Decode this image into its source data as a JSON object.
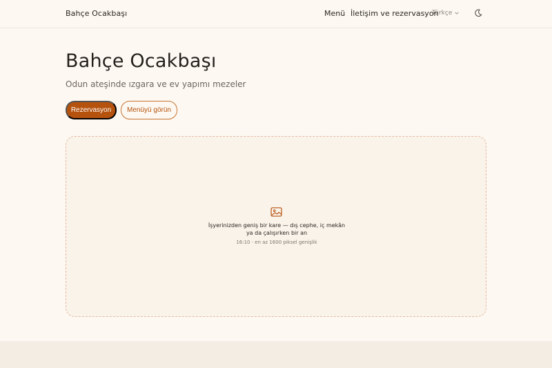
{
  "header": {
    "brand": "Bahçe Ocakbaşı",
    "nav": {
      "menu": "Menü",
      "contact": "İletişim ve rezervasyon"
    },
    "language": "Türkçe",
    "theme_icon": "moon-icon"
  },
  "hero": {
    "title": "Bahçe Ocakbaşı",
    "subtitle": "Odun ateşinde ızgara ve ev yapımı mezeler",
    "primary_button": "Rezervasyon",
    "secondary_button": "Menüyü görün"
  },
  "image_placeholder": {
    "icon": "image-icon",
    "text": "İşyerinizden geniş bir kare — dış cephe, iç mekân ya da çalışırken bir an",
    "hint": "16:10 · en az 1600 piksel genişlik"
  },
  "colors": {
    "accent": "#b5520d",
    "background": "#fdf9f2",
    "placeholder_bg": "#faf3ea",
    "placeholder_border": "#e4b9a2"
  }
}
